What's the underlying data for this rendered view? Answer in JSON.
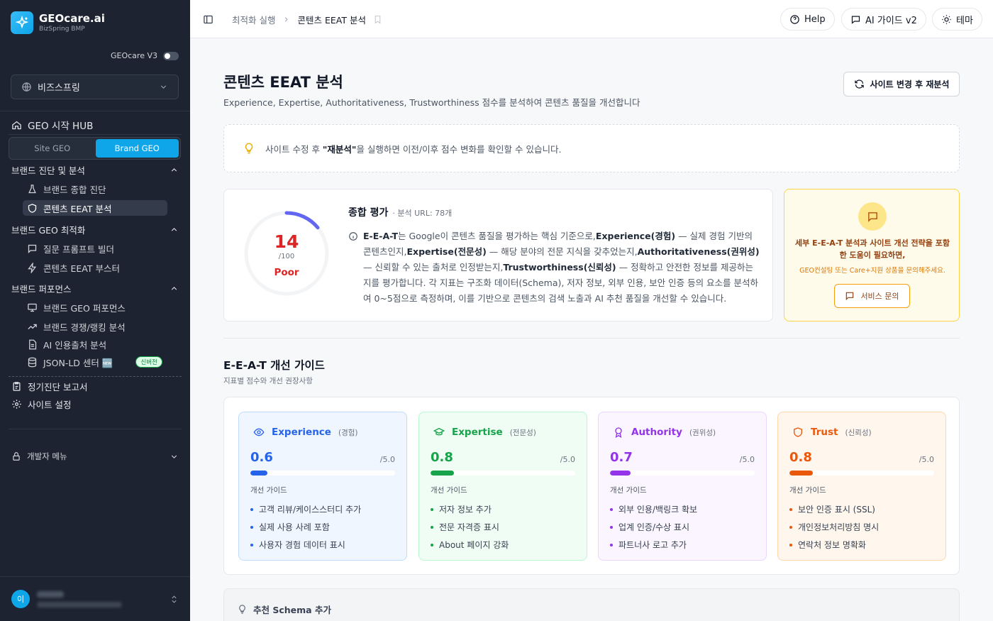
{
  "brand": {
    "name": "GEOcare.ai",
    "sub": "BizSpring BMP",
    "version_label": "GEOcare V3"
  },
  "org_select": {
    "value": "비즈스프링"
  },
  "sidebar": {
    "hub": "GEO 시작 HUB",
    "segment": {
      "left": "Site GEO",
      "right": "Brand GEO"
    },
    "groups": [
      {
        "title": "브랜드 진단 및 분석",
        "items": [
          "브랜드 종합 진단",
          "콘텐츠 EEAT 분석"
        ]
      },
      {
        "title": "브랜드 GEO 최적화",
        "items": [
          "질문 프롬프트 빌더",
          "콘텐츠 EEAT 부스터"
        ]
      },
      {
        "title": "브랜드 퍼포먼스",
        "items": [
          "브랜드 GEO 퍼포먼스",
          "브랜드 경쟁/랭킹 분석",
          "AI 인용출처 분석",
          "JSON-LD 센터 🆕"
        ]
      }
    ],
    "new_badge": "신버전",
    "report": "정기진단 보고서",
    "settings": "사이트 설정",
    "dev_menu": "개발자 메뉴",
    "avatar": "이"
  },
  "breadcrumb": {
    "parent": "최적화 실행",
    "current": "콘텐츠 EEAT 분석"
  },
  "top_buttons": {
    "help": "Help",
    "ai_guide": "AI 가이드 v2",
    "theme": "테마"
  },
  "page": {
    "title": "콘텐츠 EEAT 분석",
    "subtitle": "Experience, Expertise, Authoritativeness, Trustworthiness 점수를 분석하여 콘텐츠 품질을 개선합니다",
    "reanalyze": "사이트 변경 후 재분석"
  },
  "tip": {
    "pre": "사이트 수정 후 ",
    "bold": "\"재분석\"",
    "post": "을 실행하면 이전/이후 점수 변화를 확인할 수 있습니다."
  },
  "score": {
    "value": "14",
    "max": "/100",
    "grade": "Poor",
    "fraction": 0.14,
    "title": "종합 평가",
    "meta": "· 분석 URL: 78개",
    "desc": {
      "p1": "E-E-A-T",
      "p2": "는 Google이 콘텐츠 품질을 평가하는 핵심 기준으로,",
      "p3": "Experience(경험)",
      "p4": " — 실제 경험 기반의 콘텐츠인지,",
      "p5": "Expertise(전문성)",
      "p6": " — 해당 분야의 전문 지식을 갖추었는지,",
      "p7": "Authoritativeness(권위성)",
      "p8": " — 신뢰할 수 있는 출처로 인정받는지,",
      "p9": "Trustworthiness(신뢰성)",
      "p10": " — 정확하고 안전한 정보를 제공하는지를 평가합니다. 각 지표는 구조화 데이터(Schema), 저자 정보, 외부 인용, 보안 인증 등의 요소를 분석하여 0~5점으로 측정하며, 이를 기반으로 콘텐츠의 검색 노출과 AI 추천 품질을 개선할 수 있습니다."
    }
  },
  "consult": {
    "title": "세부 E-E-A-T 분석과 사이트 개선 전략을 포함한 도움이 필요하면,",
    "sub": "GEO컨설팅 또는 Care+지원 상품을 문의해주세요.",
    "button": "서비스 문의"
  },
  "guide": {
    "title": "E-E-A-T 개선 가이드",
    "subtitle": "지표별 점수와 개선 권장사항",
    "section_label": "개선 가이드",
    "cards": [
      {
        "name": "Experience",
        "ko": "(경험)",
        "value": "0.6",
        "max": "/5.0",
        "fraction": 0.12,
        "accent": "#2563eb",
        "bg": "#eff6ff",
        "border": "#bfdbfe",
        "items": [
          "고객 리뷰/케이스스터디 추가",
          "실제 사용 사례 포함",
          "사용자 경험 데이터 표시"
        ]
      },
      {
        "name": "Expertise",
        "ko": "(전문성)",
        "value": "0.8",
        "max": "/5.0",
        "fraction": 0.16,
        "accent": "#16a34a",
        "bg": "#f0fdf4",
        "border": "#bbf7d0",
        "items": [
          "저자 정보 추가",
          "전문 자격증 표시",
          "About 페이지 강화"
        ]
      },
      {
        "name": "Authority",
        "ko": "(권위성)",
        "value": "0.7",
        "max": "/5.0",
        "fraction": 0.14,
        "accent": "#9333ea",
        "bg": "#faf5ff",
        "border": "#e9d5ff",
        "items": [
          "외부 인용/백링크 확보",
          "업계 인증/수상 표시",
          "파트너사 로고 추가"
        ]
      },
      {
        "name": "Trust",
        "ko": "(신뢰성)",
        "value": "0.8",
        "max": "/5.0",
        "fraction": 0.16,
        "accent": "#ea580c",
        "bg": "#fff7ed",
        "border": "#fed7aa",
        "items": [
          "보안 인증 표시 (SSL)",
          "개인정보처리방침 명시",
          "연락처 정보 명확화"
        ]
      }
    ]
  },
  "schema": {
    "title": "추천 Schema 추가"
  }
}
